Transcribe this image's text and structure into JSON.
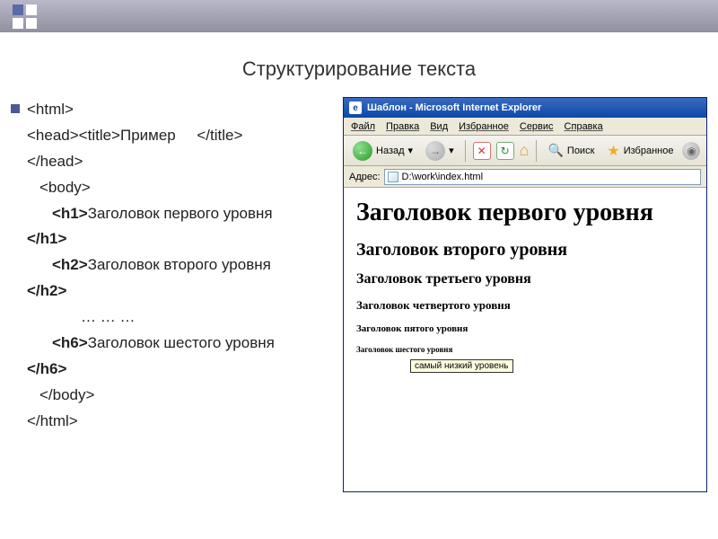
{
  "slide_title": "Структурирование текста",
  "code": {
    "l1": "<html>",
    "l2a": "<head><title>Пример",
    "l2b": "</title>",
    "l3": "</head>",
    "l4": "<body>",
    "h1_open": "<h1>",
    "h1_text": "Заголовок первого уровня",
    "h1_close": "</h1>",
    "h2_open": "<h2>",
    "h2_text": "Заголовок второго уровня",
    "h2_close": "</h2>",
    "ellipsis": "… … …",
    "h6_open": "<h6>",
    "h6_text": "Заголовок шестого уровня",
    "h6_close": "</h6>",
    "body_close": "</body>",
    "html_close": "</html>"
  },
  "ie": {
    "title": "Шаблон - Microsoft Internet Explorer",
    "menu": [
      "Файл",
      "Правка",
      "Вид",
      "Избранное",
      "Сервис",
      "Справка"
    ],
    "toolbar": {
      "back": "Назад",
      "search": "Поиск",
      "favorites": "Избранное"
    },
    "address_label": "Адрес:",
    "address_value": "D:\\work\\index.html",
    "page": {
      "h1": "Заголовок первого уровня",
      "h2": "Заголовок второго уровня",
      "h3": "Заголовок третьего уровня",
      "h4": "Заголовок четвертого уровня",
      "h5": "Заголовок пятого уровня",
      "h6": "Заголовок шестого уровня",
      "tooltip": "самый низкий уровень"
    }
  }
}
